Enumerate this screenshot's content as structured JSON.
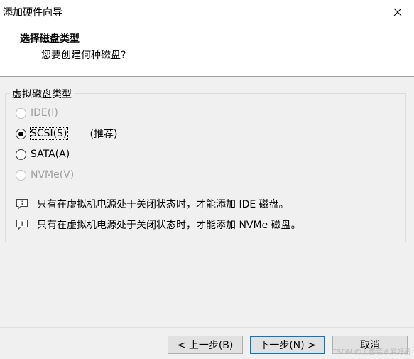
{
  "window": {
    "title": "添加硬件向导",
    "close_icon": "close-icon"
  },
  "header": {
    "title": "选择磁盘类型",
    "subtitle": "您要创建何种磁盘?"
  },
  "disk_type_group": {
    "label": "虚拟磁盘类型",
    "options": [
      {
        "label": "IDE(I)",
        "selected": false,
        "enabled": false
      },
      {
        "label": "SCSI(S)",
        "selected": true,
        "enabled": true,
        "note": "(推荐)"
      },
      {
        "label": "SATA(A)",
        "selected": false,
        "enabled": true
      },
      {
        "label": "NVMe(V)",
        "selected": false,
        "enabled": false
      }
    ]
  },
  "info_messages": [
    {
      "icon": "info-icon",
      "text": "只有在虚拟机电源处于关闭状态时，才能添加 IDE 磁盘。"
    },
    {
      "icon": "info-icon",
      "text": "只有在虚拟机电源处于关闭状态时，才能添加 NVMe 磁盘。"
    }
  ],
  "buttons": {
    "back": "< 上一步(B)",
    "next": "下一步(N) >",
    "cancel": "取消"
  },
  "watermark": "CSDN @上善若水爱好者"
}
